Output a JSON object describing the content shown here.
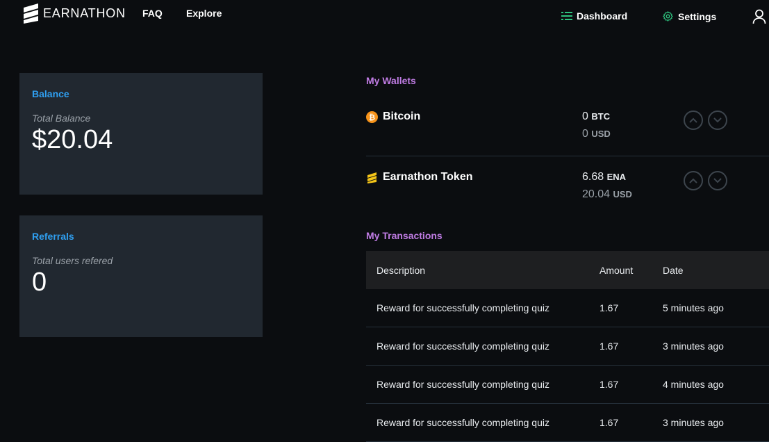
{
  "header": {
    "brand": "EARNATHON",
    "nav": {
      "faq": "FAQ",
      "explore": "Explore"
    },
    "dashboard_label": "Dashboard",
    "settings_label": "Settings",
    "accent_color": "#2ec27e"
  },
  "balance_card": {
    "title": "Balance",
    "subtitle": "Total Balance",
    "value": "$20.04"
  },
  "referrals_card": {
    "title": "Referrals",
    "subtitle": "Total users refered",
    "value": "0"
  },
  "wallets": {
    "title": "My Wallets",
    "items": [
      {
        "name": "Bitcoin",
        "amount": "0",
        "unit": "BTC",
        "usd": "0",
        "usd_unit": "USD",
        "icon": "bitcoin-icon",
        "icon_color": "#f7931a"
      },
      {
        "name": "Earnathon Token",
        "amount": "6.68",
        "unit": "ENA",
        "usd": "20.04",
        "usd_unit": "USD",
        "icon": "earnathon-token-icon",
        "icon_color": "#f5c518"
      }
    ]
  },
  "transactions": {
    "title": "My Transactions",
    "columns": [
      "Description",
      "Amount",
      "Date"
    ],
    "rows": [
      {
        "description": "Reward for successfully completing quiz",
        "amount": "1.67",
        "date": "5 minutes ago"
      },
      {
        "description": "Reward for successfully completing quiz",
        "amount": "1.67",
        "date": "3 minutes ago"
      },
      {
        "description": "Reward for successfully completing quiz",
        "amount": "1.67",
        "date": "4 minutes ago"
      },
      {
        "description": "Reward for successfully completing quiz",
        "amount": "1.67",
        "date": "3 minutes ago"
      }
    ]
  },
  "colors": {
    "background": "#0b0d10",
    "card": "#212830",
    "card_title": "#2f9ff0",
    "section_title": "#c07ce4"
  }
}
